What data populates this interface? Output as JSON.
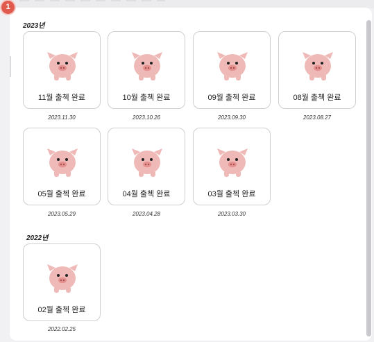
{
  "badge": "1",
  "sections": [
    {
      "year": "2023년",
      "items": [
        {
          "label": "11월 출첵 완료",
          "date": "2023.11.30"
        },
        {
          "label": "10월 출첵 완료",
          "date": "2023.10.26"
        },
        {
          "label": "09월 출첵 완료",
          "date": "2023.09.30"
        },
        {
          "label": "08월 출첵 완료",
          "date": "2023.08.27"
        },
        {
          "label": "05월 출첵 완료",
          "date": "2023.05.29"
        },
        {
          "label": "04월 출첵 완료",
          "date": "2023.04.28"
        },
        {
          "label": "03월 출첵 완료",
          "date": "2023.03.30"
        }
      ]
    },
    {
      "year": "2022년",
      "items": [
        {
          "label": "02월 출첵 완료",
          "date": "2022.02.25"
        }
      ]
    }
  ],
  "colors": {
    "pig": "#eeb9b6",
    "snout": "#e58f8e",
    "accent": "#e05a4e"
  },
  "icons": {
    "stamp": "pig-icon"
  }
}
